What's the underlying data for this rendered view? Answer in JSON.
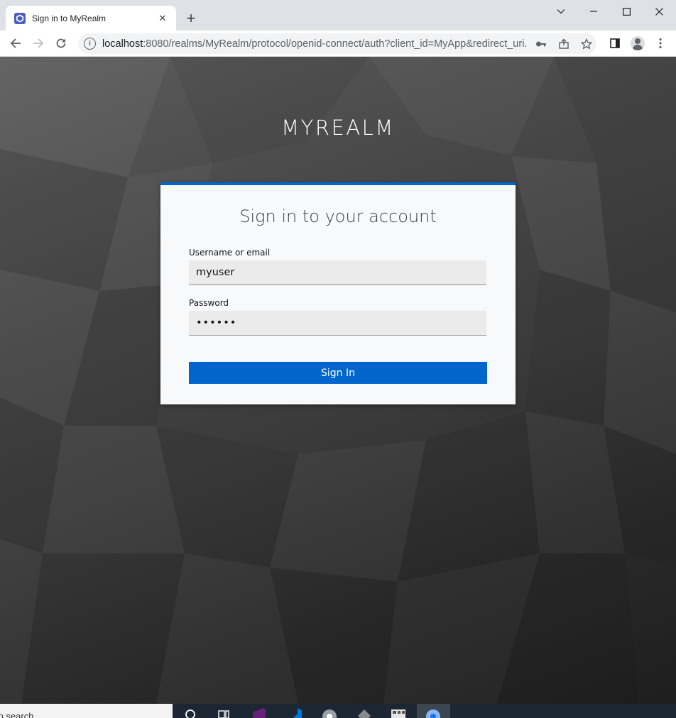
{
  "browser": {
    "tab_title": "Sign in to MyRealm",
    "tab_close": "✕",
    "new_tab": "+",
    "url_host": "localhost",
    "url_rest": ":8080/realms/MyRealm/protocol/openid-connect/auth?client_id=MyApp&redirect_uri...",
    "icons": {
      "back": "arrow-left-icon",
      "forward": "arrow-right-icon",
      "reload": "reload-icon",
      "site_info": "info-icon",
      "password_key": "key-icon",
      "share": "share-icon",
      "bookmark": "star-icon",
      "side_panel": "side-panel-icon",
      "profile": "avatar",
      "menu": "kebab-menu-icon"
    }
  },
  "login": {
    "realm_name": "MYREALM",
    "title": "Sign in to your account",
    "username_label": "Username or email",
    "username_value": "myuser",
    "password_label": "Password",
    "password_value": "••••••",
    "submit_label": "Sign In",
    "accent_color": "#0066cc"
  },
  "taskbar": {
    "search_text": "to search"
  }
}
